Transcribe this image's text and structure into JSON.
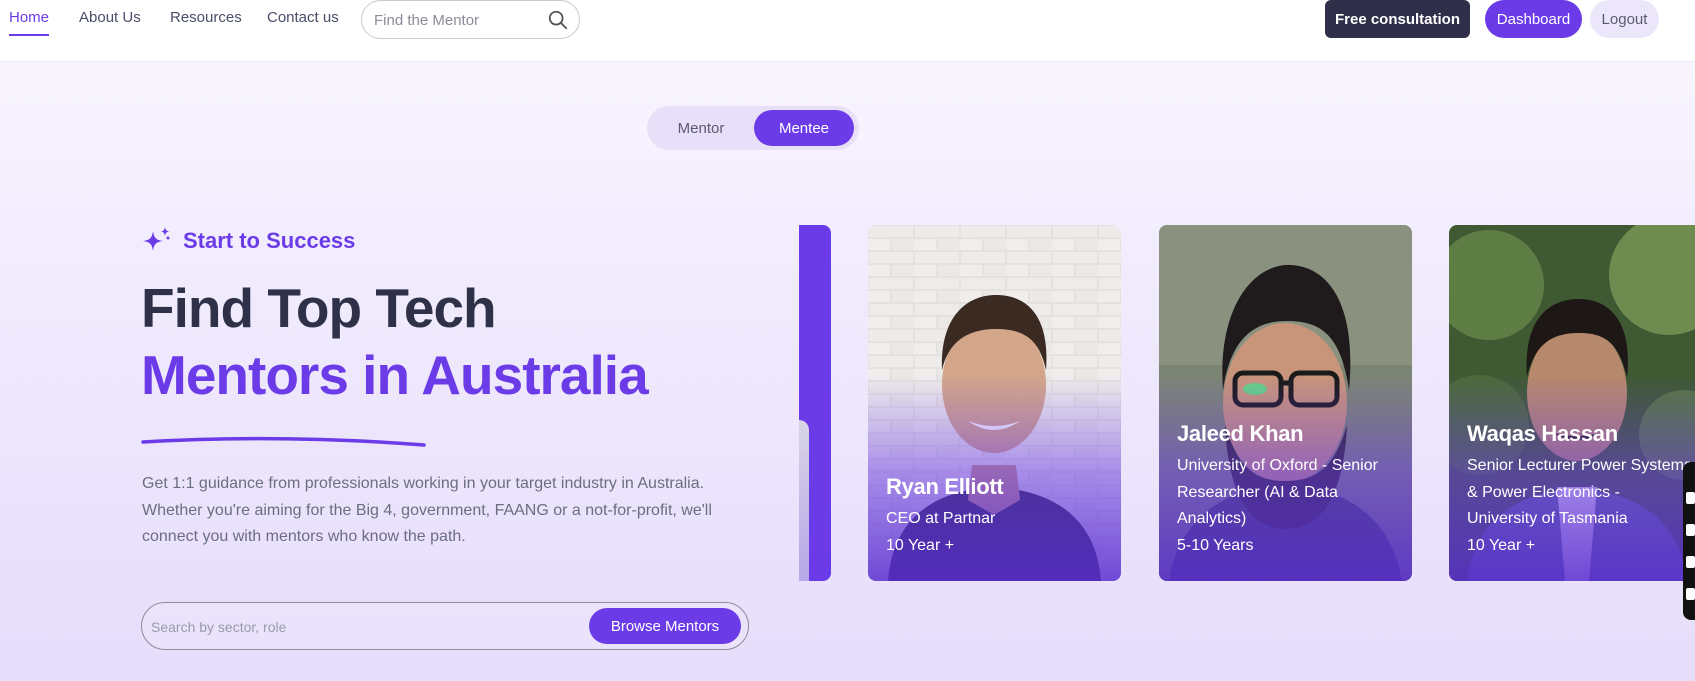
{
  "nav": {
    "links": [
      {
        "label": "Home",
        "active": true
      },
      {
        "label": "About Us",
        "active": false
      },
      {
        "label": "Resources",
        "active": false
      },
      {
        "label": "Contact us",
        "active": false
      }
    ],
    "search_placeholder": "Find the Mentor",
    "consult_label": "Free consultation",
    "dashboard_label": "Dashboard",
    "logout_label": "Logout"
  },
  "toggle": {
    "options": [
      "Mentor",
      "Mentee"
    ],
    "selected": "Mentee"
  },
  "hero": {
    "eyebrow": "Start to Success",
    "title_line1": "Find Top Tech",
    "title_line2": "Mentors in Australia",
    "description": "Get 1:1 guidance from professionals working in your target industry in Australia. Whether you're aiming for the Big 4, government, FAANG or a not-for-profit, we'll connect you with mentors who know the path.",
    "search_placeholder": "Search by sector, role",
    "browse_label": "Browse Mentors"
  },
  "mentors": [
    {
      "name": "Ryan Elliott",
      "role": "CEO at Partnar",
      "experience": "10 Year +"
    },
    {
      "name": "Jaleed Khan",
      "role": "University of Oxford - Senior Researcher (AI & Data Analytics)",
      "experience": "5-10 Years"
    },
    {
      "name": "Waqas Hassan",
      "role": "Senior Lecturer Power Systems & Power Electronics - University of Tasmania",
      "experience": "10 Year +"
    }
  ],
  "colors": {
    "accent": "#6b3be8",
    "dark": "#2f2f4a",
    "background": "#f3eefc"
  },
  "icons": [
    "search-icon",
    "sparkle-icon"
  ]
}
